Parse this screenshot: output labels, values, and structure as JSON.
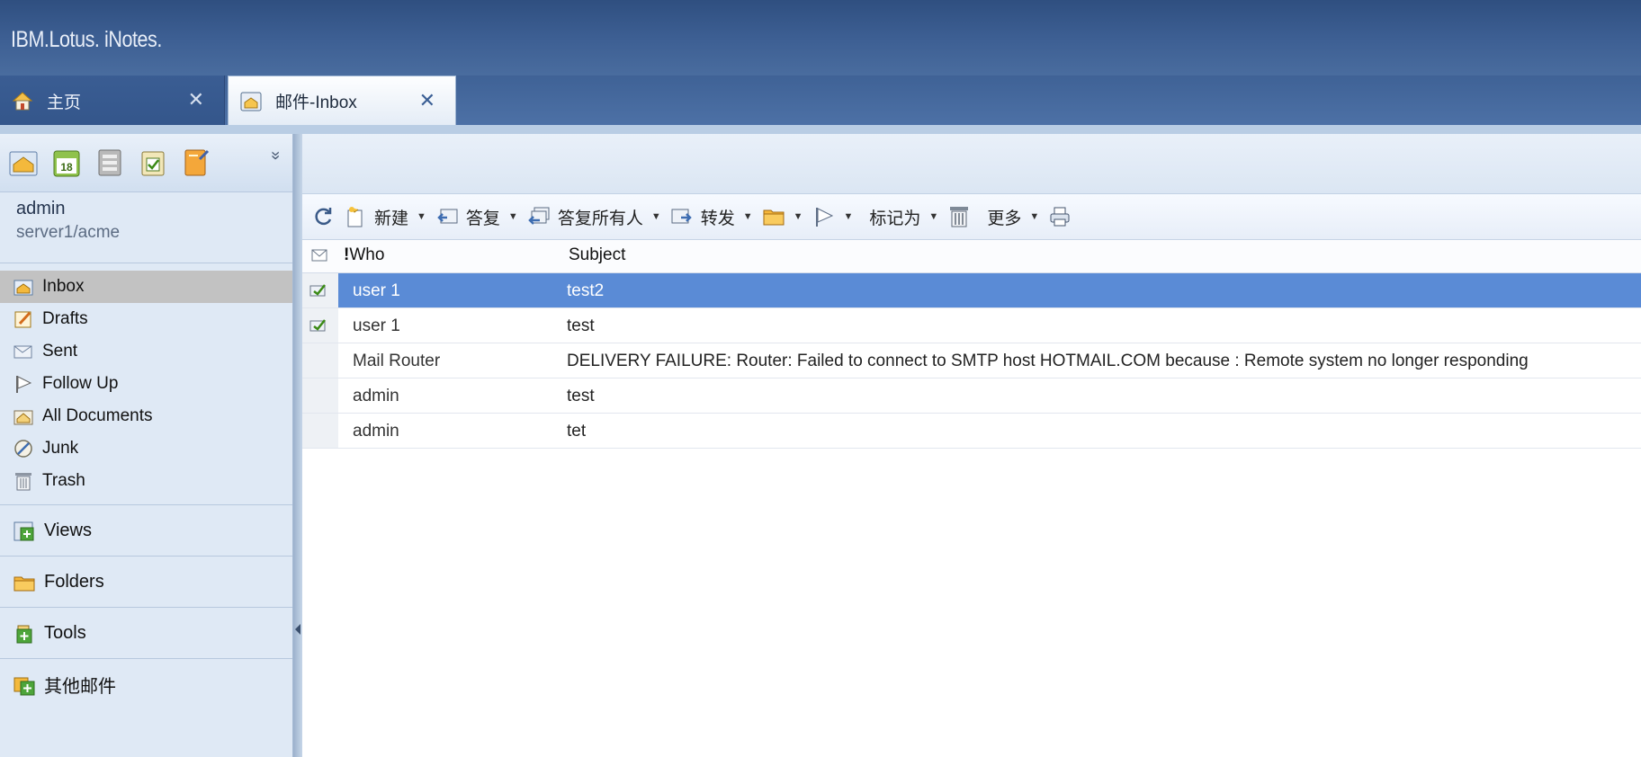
{
  "app": {
    "brand": "IBM.Lotus. iNotes."
  },
  "tabs": [
    {
      "label": "主页",
      "icon": "home-icon",
      "active": false
    },
    {
      "label": "邮件-Inbox",
      "icon": "mail-tab-icon",
      "active": true
    }
  ],
  "tab_close": "✕",
  "user": {
    "name": "admin",
    "server": "server1/acme"
  },
  "app_launcher": {
    "icons": [
      "mail-app-icon",
      "calendar-app-icon",
      "contacts-app-icon",
      "todo-app-icon",
      "notebook-app-icon"
    ],
    "calendar_day": "18",
    "more": "»"
  },
  "nav": [
    {
      "label": "Inbox",
      "icon": "inbox-icon",
      "selected": true
    },
    {
      "label": "Drafts",
      "icon": "drafts-icon",
      "selected": false
    },
    {
      "label": "Sent",
      "icon": "sent-icon",
      "selected": false
    },
    {
      "label": "Follow Up",
      "icon": "flag-icon",
      "selected": false
    },
    {
      "label": "All Documents",
      "icon": "all-documents-icon",
      "selected": false
    },
    {
      "label": "Junk",
      "icon": "junk-icon",
      "selected": false
    },
    {
      "label": "Trash",
      "icon": "trash-icon",
      "selected": false
    }
  ],
  "sections": [
    {
      "label": "Views",
      "icon": "views-icon"
    },
    {
      "label": "Folders",
      "icon": "folder-icon"
    },
    {
      "label": "Tools",
      "icon": "tools-icon"
    },
    {
      "label": "其他邮件",
      "icon": "other-mail-icon"
    }
  ],
  "toolbar": {
    "new_label": "新建",
    "reply_label": "答复",
    "reply_all_label": "答复所有人",
    "forward_label": "转发",
    "mark_as_label": "标记为",
    "more_label": "更多",
    "caret": "▼"
  },
  "list": {
    "columns": {
      "who": "Who",
      "subject": "Subject"
    },
    "importance_marker": "!",
    "rows": [
      {
        "who": "user 1",
        "subject": "test2",
        "selected": true,
        "flag": true
      },
      {
        "who": "user 1",
        "subject": "test",
        "selected": false,
        "flag": true
      },
      {
        "who": "Mail Router",
        "subject": "DELIVERY FAILURE: Router: Failed to connect to SMTP host HOTMAIL.COM because : Remote system no longer responding",
        "selected": false,
        "flag": false
      },
      {
        "who": "admin",
        "subject": "test",
        "selected": false,
        "flag": false
      },
      {
        "who": "admin",
        "subject": "tet",
        "selected": false,
        "flag": false
      }
    ]
  },
  "colors": {
    "banner": "#3d5f93",
    "selection": "#5a8bd6",
    "sidebar": "#dfe9f5",
    "nav_selected": "#c2c2c2"
  }
}
